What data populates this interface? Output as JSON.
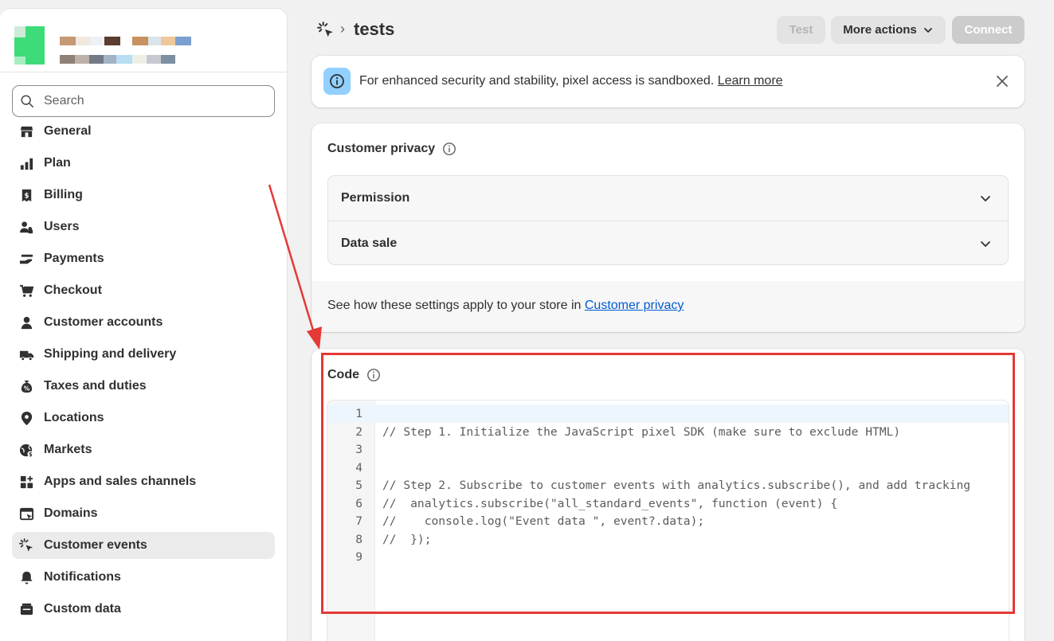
{
  "sidebar": {
    "search_placeholder": "Search",
    "items": [
      {
        "label": "General",
        "icon": "store-icon"
      },
      {
        "label": "Plan",
        "icon": "plan-icon"
      },
      {
        "label": "Billing",
        "icon": "receipt-dollar-icon"
      },
      {
        "label": "Users",
        "icon": "users-icon"
      },
      {
        "label": "Payments",
        "icon": "payments-hand-icon"
      },
      {
        "label": "Checkout",
        "icon": "cart-icon"
      },
      {
        "label": "Customer accounts",
        "icon": "person-icon"
      },
      {
        "label": "Shipping and delivery",
        "icon": "truck-icon"
      },
      {
        "label": "Taxes and duties",
        "icon": "money-bag-icon"
      },
      {
        "label": "Locations",
        "icon": "location-pin-icon"
      },
      {
        "label": "Markets",
        "icon": "globe-dollar-icon"
      },
      {
        "label": "Apps and sales channels",
        "icon": "apps-icon"
      },
      {
        "label": "Domains",
        "icon": "domain-icon"
      },
      {
        "label": "Customer events",
        "icon": "cursor-click-icon",
        "active": true
      },
      {
        "label": "Notifications",
        "icon": "bell-icon"
      },
      {
        "label": "Custom data",
        "icon": "database-icon"
      }
    ]
  },
  "topbar": {
    "separator": "›",
    "title": "tests",
    "test_label": "Test",
    "more_actions_label": "More actions",
    "connect_label": "Connect"
  },
  "banner": {
    "text": "For enhanced security and stability, pixel access is sandboxed.",
    "link": "Learn more"
  },
  "privacy": {
    "title": "Customer privacy",
    "rows": [
      "Permission",
      "Data sale"
    ],
    "footer_text": "See how these settings apply to your store in",
    "footer_link": "Customer privacy"
  },
  "code": {
    "title": "Code",
    "lines": [
      "",
      "// Step 1. Initialize the JavaScript pixel SDK (make sure to exclude HTML)",
      "",
      "",
      "// Step 2. Subscribe to customer events with analytics.subscribe(), and add tracking",
      "//  analytics.subscribe(\"all_standard_events\", function (event) {",
      "//    console.log(\"Event data \", event?.data);",
      "//  });",
      ""
    ]
  },
  "colors": {
    "annotation_red": "#e53935",
    "link_blue": "#005bd3",
    "info_blue": "#91d0ff"
  }
}
